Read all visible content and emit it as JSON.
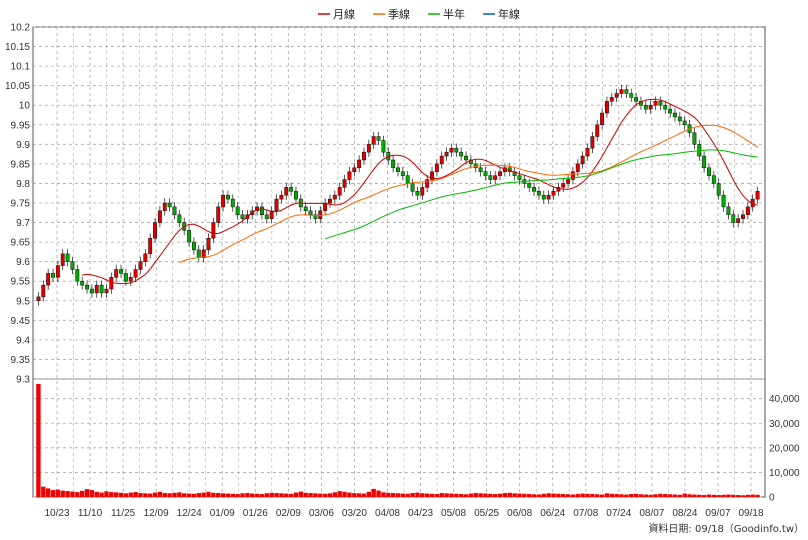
{
  "legend": [
    {
      "label": "月線",
      "color": "#cc0000"
    },
    {
      "label": "季線",
      "color": "#ff6600"
    },
    {
      "label": "半年",
      "color": "#00bb00"
    },
    {
      "label": "年線",
      "color": "#0055cc"
    }
  ],
  "source_note": "資料日期: 09/18（Goodinfo.tw）",
  "colors": {
    "up": "#e00000",
    "down": "#00aa00",
    "volume": "#ee0000",
    "grid": "#aaaaaa"
  },
  "chart_data": {
    "type": "candlestick",
    "y_ticks": [
      "10.2",
      "10.15",
      "10.1",
      "10.05",
      "10",
      "9.95",
      "9.9",
      "9.85",
      "9.8",
      "9.75",
      "9.7",
      "9.65",
      "9.6",
      "9.55",
      "9.5",
      "9.45",
      "9.4",
      "9.35",
      "9.3"
    ],
    "ylim": [
      9.3,
      10.2
    ],
    "volume_ticks": [
      "40,000",
      "30,000",
      "20,000",
      "10,000",
      "0"
    ],
    "volume_ylim": [
      0,
      48000
    ],
    "x_ticks": [
      "10/23",
      "11/10",
      "11/25",
      "12/09",
      "12/24",
      "01/09",
      "01/26",
      "02/09",
      "03/06",
      "03/20",
      "04/08",
      "04/23",
      "05/08",
      "05/25",
      "06/08",
      "06/24",
      "07/08",
      "07/24",
      "08/07",
      "08/24",
      "09/07",
      "09/18"
    ],
    "close": [
      9.51,
      9.54,
      9.57,
      9.56,
      9.59,
      9.62,
      9.6,
      9.58,
      9.55,
      9.54,
      9.53,
      9.52,
      9.54,
      9.52,
      9.53,
      9.56,
      9.58,
      9.57,
      9.55,
      9.56,
      9.58,
      9.6,
      9.62,
      9.66,
      9.7,
      9.73,
      9.75,
      9.74,
      9.72,
      9.7,
      9.68,
      9.65,
      9.63,
      9.61,
      9.63,
      9.66,
      9.7,
      9.74,
      9.77,
      9.76,
      9.74,
      9.72,
      9.71,
      9.72,
      9.73,
      9.74,
      9.72,
      9.71,
      9.73,
      9.76,
      9.77,
      9.79,
      9.78,
      9.76,
      9.74,
      9.73,
      9.72,
      9.71,
      9.73,
      9.75,
      9.76,
      9.77,
      9.79,
      9.81,
      9.83,
      9.84,
      9.86,
      9.88,
      9.9,
      9.92,
      9.91,
      9.88,
      9.86,
      9.84,
      9.83,
      9.82,
      9.8,
      9.78,
      9.77,
      9.79,
      9.81,
      9.83,
      9.85,
      9.87,
      9.88,
      9.89,
      9.88,
      9.87,
      9.86,
      9.85,
      9.84,
      9.83,
      9.82,
      9.81,
      9.82,
      9.83,
      9.84,
      9.83,
      9.82,
      9.81,
      9.8,
      9.79,
      9.78,
      9.77,
      9.76,
      9.77,
      9.78,
      9.79,
      9.8,
      9.81,
      9.83,
      9.85,
      9.87,
      9.89,
      9.92,
      9.95,
      9.98,
      10.01,
      10.02,
      10.03,
      10.04,
      10.03,
      10.02,
      10.01,
      10.0,
      9.99,
      10.0,
      10.01,
      10.0,
      9.99,
      9.98,
      9.97,
      9.96,
      9.95,
      9.93,
      9.9,
      9.87,
      9.84,
      9.82,
      9.8,
      9.77,
      9.74,
      9.72,
      9.7,
      9.71,
      9.72,
      9.74,
      9.76,
      9.78
    ],
    "volume_sample": [
      46000,
      4200,
      3500,
      2800,
      3000,
      2600,
      2400,
      2200,
      2000,
      2500,
      3200,
      2800,
      2100,
      1800,
      2300,
      2000,
      1900,
      1700,
      1500,
      1800,
      2000,
      1600,
      1500,
      1400,
      1800,
      2100,
      1600,
      1500,
      1700,
      1900,
      1500,
      1400,
      1300,
      1600,
      1800,
      2100,
      1700,
      1600,
      1500,
      1400,
      1300,
      1200,
      1500,
      1600,
      1400,
      1300,
      1200,
      1500,
      1700,
      1600,
      1500,
      1400,
      1300,
      1800,
      2200,
      1700,
      1600,
      1500,
      1400,
      1300,
      1500,
      1900,
      2400,
      2100,
      1800,
      1600,
      1500,
      1400,
      2100,
      3300,
      2600,
      1900,
      1700,
      1600,
      1500,
      1400,
      1300,
      1600,
      1800,
      1500,
      1400,
      1300,
      1200,
      1600,
      1500,
      1400,
      1300,
      1200,
      1100,
      1400,
      1600,
      1500,
      1400,
      1300,
      1200,
      1300,
      1600,
      1700,
      1500,
      1400,
      1300,
      1200,
      1100,
      1000,
      1300,
      1500,
      1400,
      1300,
      1200,
      1100,
      1000,
      1200,
      1400,
      1300,
      1200,
      1100,
      1000,
      1500,
      1300,
      1200,
      1100,
      1000,
      1200,
      1300,
      1100,
      1000,
      900,
      1100,
      1300,
      1200,
      1100,
      1000,
      900,
      1400,
      1100,
      1000,
      900,
      800,
      1000,
      900,
      800,
      900,
      1000,
      900,
      800,
      700,
      900,
      1000,
      900,
      800
    ]
  }
}
